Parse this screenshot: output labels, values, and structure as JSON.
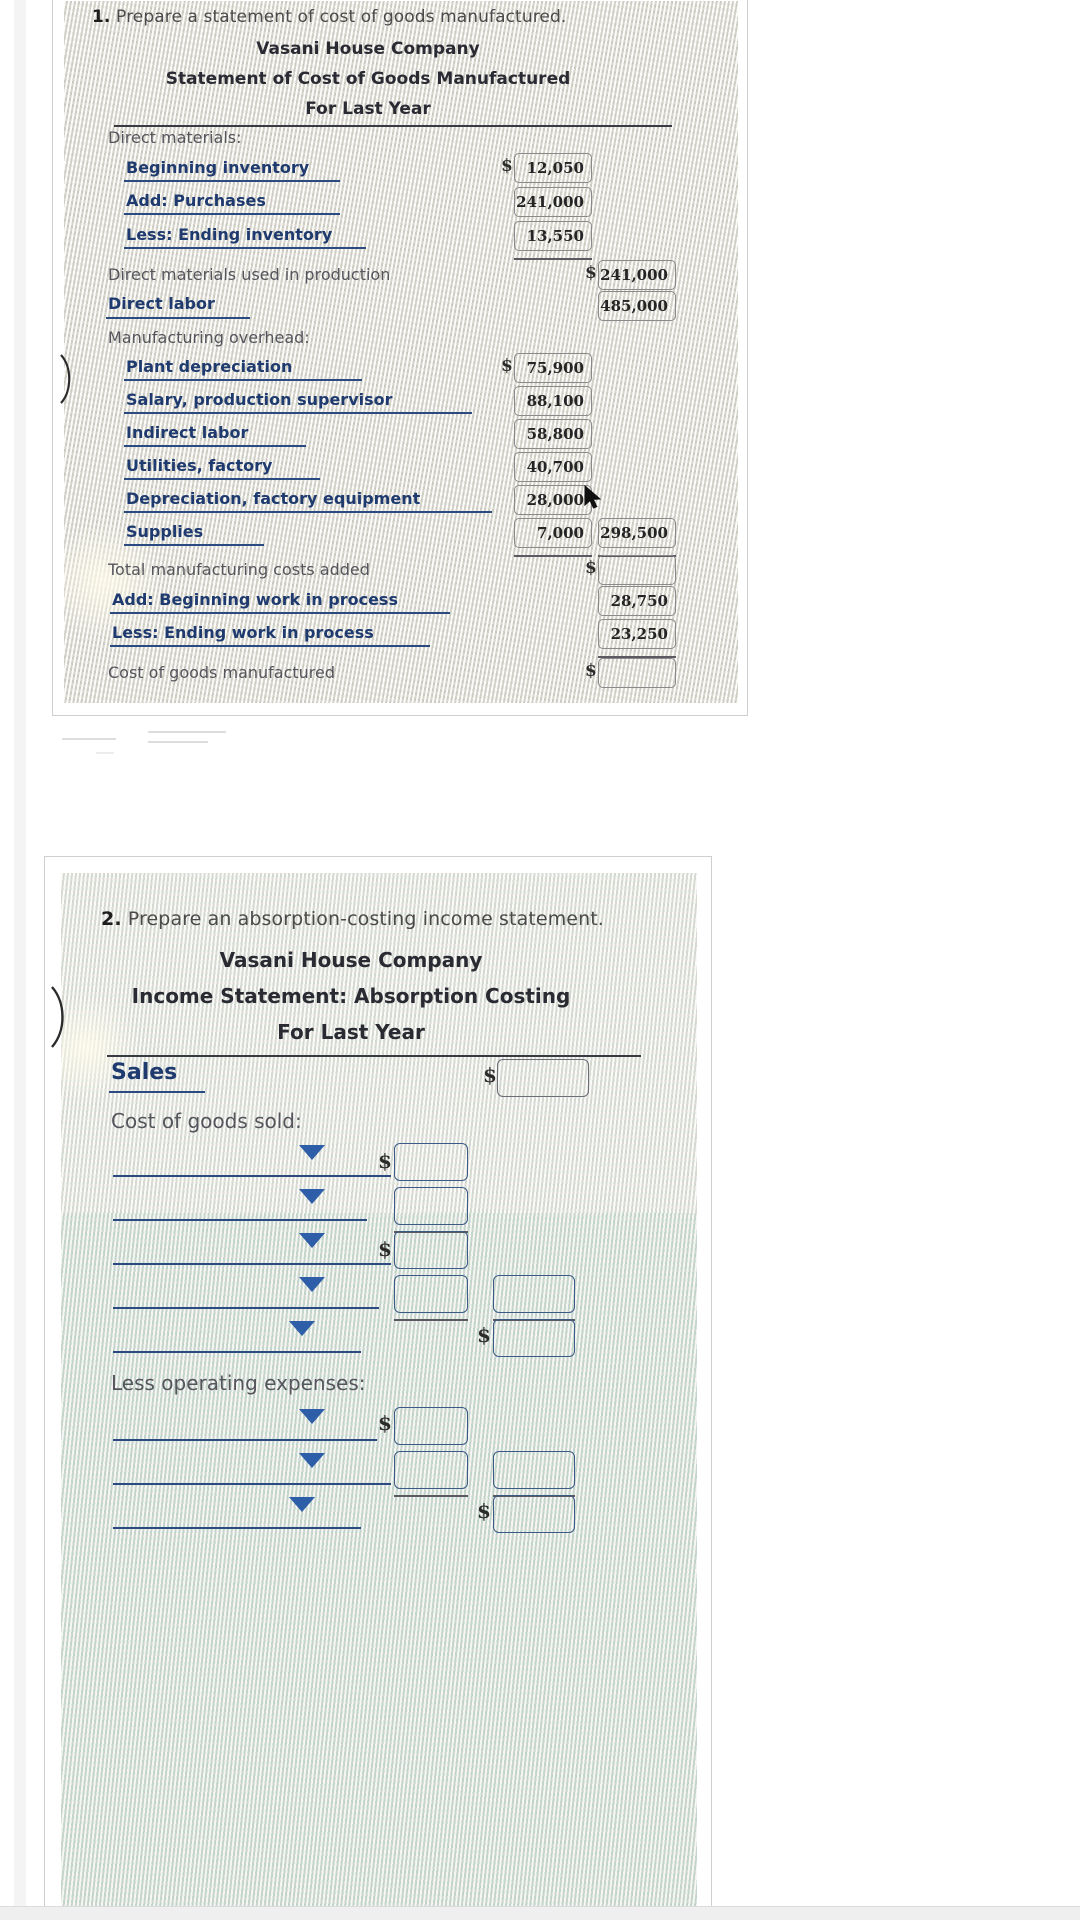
{
  "page": {
    "background": "#ffffff",
    "accent_blue": "#1e3a6e",
    "caret_blue": "#2f5ea8",
    "paper_tint_1": "#e4e2da",
    "paper_tint_2": "#e9e7e0"
  },
  "question1": {
    "number": "1.",
    "prompt": "Prepare a statement of cost of goods manufactured.",
    "company": "Vasani House Company",
    "statement_title": "Statement of Cost of Goods Manufactured",
    "period": "For Last Year",
    "section_direct_materials": "Direct materials:",
    "section_overhead": "Manufacturing overhead:",
    "rows": [
      {
        "label": "Beginning inventory",
        "style": "blue",
        "dollar": "$",
        "col1": "12,050",
        "col2": ""
      },
      {
        "label": "Add: Purchases",
        "style": "blue",
        "dollar": "",
        "col1": "241,000",
        "col2": ""
      },
      {
        "label": "Less: Ending inventory",
        "style": "blue",
        "dollar": "",
        "col1": "13,550",
        "col2": ""
      },
      {
        "label": "Direct materials used in production",
        "style": "plain",
        "dollar": "$",
        "col1": "",
        "col2": "241,000"
      },
      {
        "label": "Direct labor",
        "style": "blue",
        "dollar": "",
        "col1": "",
        "col2": "485,000"
      },
      {
        "label": "Plant depreciation",
        "style": "blue",
        "dollar": "$",
        "col1": "75,900",
        "col2": ""
      },
      {
        "label": "Salary, production supervisor",
        "style": "blue",
        "dollar": "",
        "col1": "88,100",
        "col2": ""
      },
      {
        "label": "Indirect labor",
        "style": "blue",
        "dollar": "",
        "col1": "58,800",
        "col2": ""
      },
      {
        "label": "Utilities, factory",
        "style": "blue",
        "dollar": "",
        "col1": "40,700",
        "col2": ""
      },
      {
        "label": "Depreciation, factory equipment",
        "style": "blue",
        "dollar": "",
        "col1": "28,000",
        "col2": ""
      },
      {
        "label": "Supplies",
        "style": "blue",
        "dollar": "",
        "col1": "7,000",
        "col2": "298,500"
      },
      {
        "label": "Total manufacturing costs added",
        "style": "plain",
        "dollar": "$",
        "col1": "",
        "col2": ""
      },
      {
        "label": "Add: Beginning work in process",
        "style": "blue",
        "dollar": "",
        "col1": "",
        "col2": "28,750"
      },
      {
        "label": "Less: Ending work in process",
        "style": "blue",
        "dollar": "",
        "col1": "",
        "col2": "23,250"
      },
      {
        "label": "Cost of goods manufactured",
        "style": "plain",
        "dollar": "$",
        "col1": "",
        "col2": ""
      }
    ]
  },
  "question2": {
    "number": "2.",
    "prompt": "Prepare an absorption-costing income statement.",
    "company": "Vasani House Company",
    "statement_title": "Income Statement: Absorption Costing",
    "period": "For Last Year",
    "sales_label": "Sales",
    "sales_dollar": "$",
    "cogs_label": "Cost of goods sold:",
    "operating_label": "Less operating expenses:",
    "cogs_rows": [
      {
        "dropdown": "",
        "dollar": "$",
        "col1": "",
        "col2": ""
      },
      {
        "dropdown": "",
        "dollar": "",
        "col1": "",
        "col2": ""
      },
      {
        "dropdown": "",
        "dollar": "$",
        "col1": "",
        "col2": ""
      },
      {
        "dropdown": "",
        "dollar": "",
        "col1": "",
        "col2": ""
      },
      {
        "dropdown": "",
        "dollar": "$",
        "col1": "",
        "col2": ""
      }
    ],
    "opex_rows": [
      {
        "dropdown": "",
        "dollar": "$",
        "col1": "",
        "col2": ""
      },
      {
        "dropdown": "",
        "dollar": "",
        "col1": "",
        "col2": ""
      },
      {
        "dropdown": "",
        "dollar": "$",
        "col1": "",
        "col2": ""
      }
    ]
  }
}
